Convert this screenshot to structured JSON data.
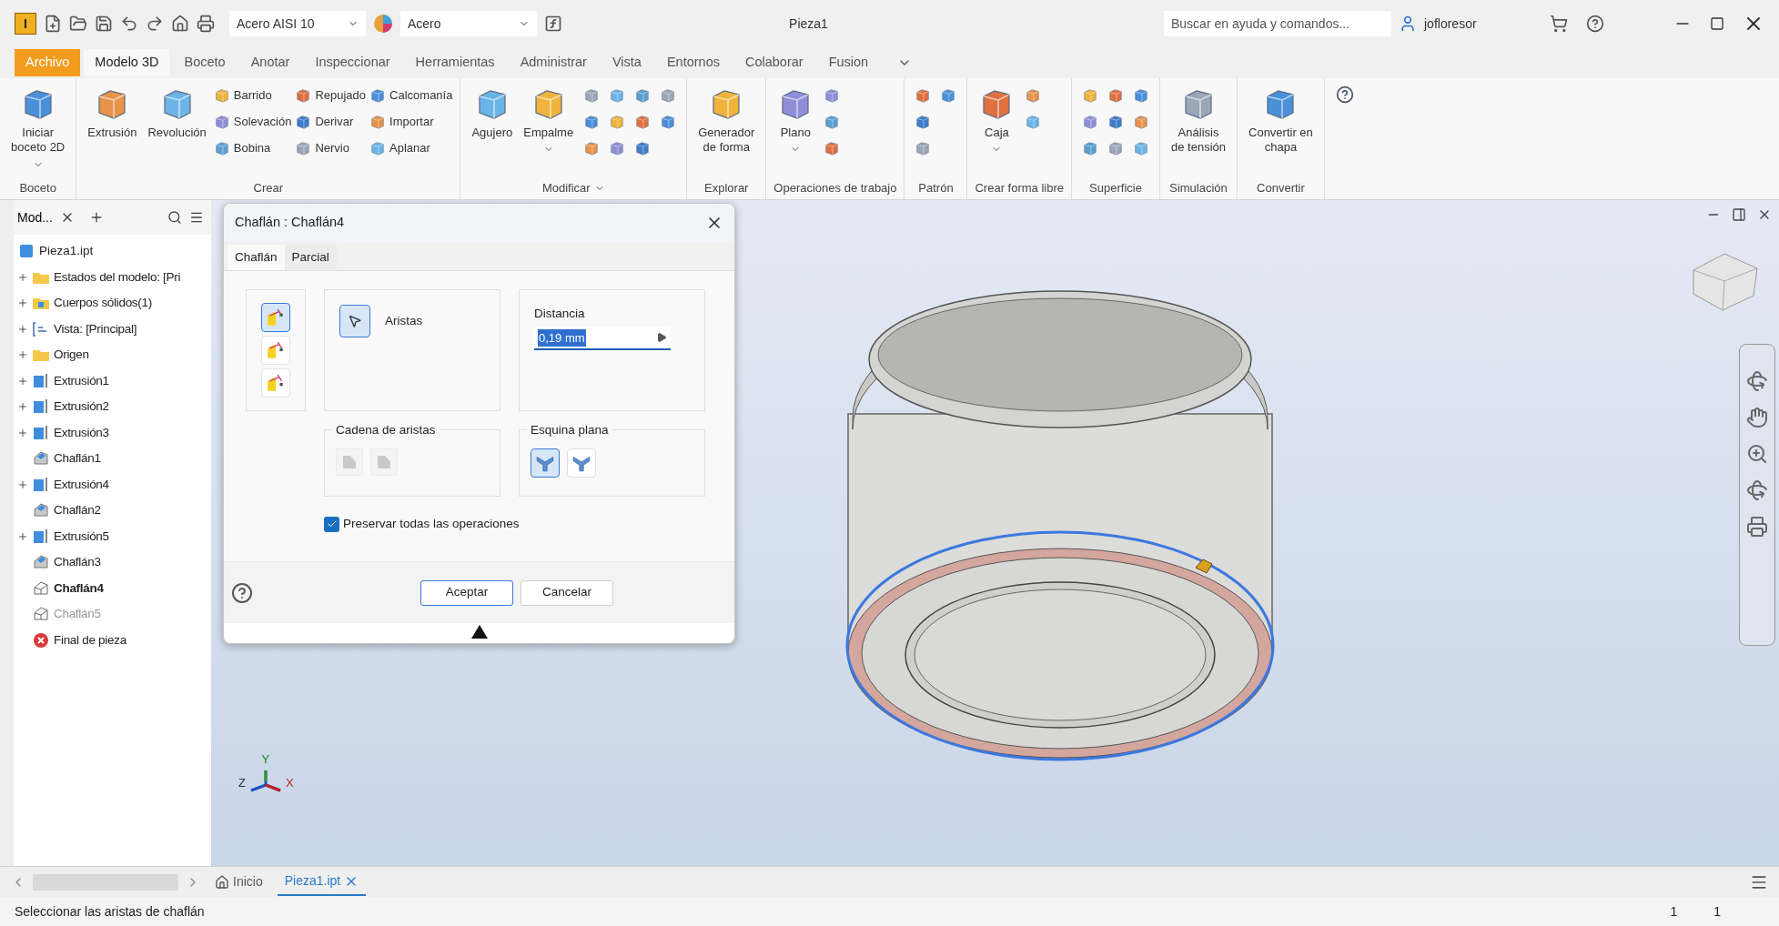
{
  "title_bar": {
    "logo": "I",
    "material": "Acero AISI 10",
    "appearance": "Acero",
    "document": "Pieza1",
    "search": {
      "placeholder": "Buscar en ayuda y comandos..."
    },
    "user": "jofloresor"
  },
  "menu_tabs": [
    {
      "label": "Archivo",
      "kind": "file",
      "selected": false
    },
    {
      "label": "Modelo 3D",
      "kind": "tab",
      "selected": true
    },
    {
      "label": "Boceto",
      "kind": "tab",
      "selected": false
    },
    {
      "label": "Anotar",
      "kind": "tab",
      "selected": false
    },
    {
      "label": "Inspeccionar",
      "kind": "tab",
      "selected": false
    },
    {
      "label": "Herramientas",
      "kind": "tab",
      "selected": false
    },
    {
      "label": "Administrar",
      "kind": "tab",
      "selected": false
    },
    {
      "label": "Vista",
      "kind": "tab",
      "selected": false
    },
    {
      "label": "Entornos",
      "kind": "tab",
      "selected": false
    },
    {
      "label": "Colaborar",
      "kind": "tab",
      "selected": false
    },
    {
      "label": "Fusion",
      "kind": "tab",
      "selected": false
    }
  ],
  "ribbon": [
    {
      "label": "Boceto",
      "dropdown": false,
      "tools": [
        {
          "kind": "large",
          "label": "Iniciar\nboceto 2D",
          "dropdown": true
        }
      ]
    },
    {
      "label": "Crear",
      "dropdown": false,
      "tools": [
        {
          "kind": "large",
          "label": "Extrusión",
          "dropdown": false
        },
        {
          "kind": "large",
          "label": "Revolución",
          "dropdown": false
        },
        {
          "kind": "small",
          "label": "Barrido"
        },
        {
          "kind": "small",
          "label": "Solevación"
        },
        {
          "kind": "small",
          "label": "Bobina"
        },
        {
          "kind": "small",
          "label": "Repujado"
        },
        {
          "kind": "small",
          "label": "Derivar"
        },
        {
          "kind": "small",
          "label": "Nervio"
        },
        {
          "kind": "small",
          "label": "Calcomanía"
        },
        {
          "kind": "small",
          "label": "Importar"
        },
        {
          "kind": "small",
          "label": "Aplanar"
        }
      ]
    },
    {
      "label": "Modificar",
      "dropdown": true,
      "tools": [
        {
          "kind": "large",
          "label": "Agujero",
          "dropdown": false
        },
        {
          "kind": "large",
          "label": "Empalme",
          "dropdown": true
        },
        {
          "kind": "icon"
        },
        {
          "kind": "icon"
        },
        {
          "kind": "icon"
        },
        {
          "kind": "icon"
        },
        {
          "kind": "icon"
        },
        {
          "kind": "icon"
        },
        {
          "kind": "icon"
        },
        {
          "kind": "icon"
        },
        {
          "kind": "icon"
        },
        {
          "kind": "icon"
        },
        {
          "kind": "icon"
        }
      ]
    },
    {
      "label": "Explorar",
      "dropdown": false,
      "tools": [
        {
          "kind": "large",
          "label": "Generador\nde forma",
          "dropdown": false
        }
      ]
    },
    {
      "label": "Operaciones de trabajo",
      "dropdown": false,
      "tools": [
        {
          "kind": "large",
          "label": "Plano",
          "dropdown": true
        },
        {
          "kind": "icon"
        },
        {
          "kind": "icon"
        },
        {
          "kind": "icon"
        }
      ]
    },
    {
      "label": "Patrón",
      "dropdown": false,
      "tools": [
        {
          "kind": "icon"
        },
        {
          "kind": "icon"
        },
        {
          "kind": "icon"
        },
        {
          "kind": "icon"
        }
      ]
    },
    {
      "label": "Crear forma libre",
      "dropdown": false,
      "tools": [
        {
          "kind": "large",
          "label": "Caja",
          "dropdown": true
        },
        {
          "kind": "icon"
        },
        {
          "kind": "icon"
        }
      ]
    },
    {
      "label": "Superficie",
      "dropdown": false,
      "tools": [
        {
          "kind": "icon"
        },
        {
          "kind": "icon"
        },
        {
          "kind": "icon"
        },
        {
          "kind": "icon"
        },
        {
          "kind": "icon"
        },
        {
          "kind": "icon"
        },
        {
          "kind": "icon"
        },
        {
          "kind": "icon"
        },
        {
          "kind": "icon"
        }
      ]
    },
    {
      "label": "Simulación",
      "dropdown": false,
      "tools": [
        {
          "kind": "large",
          "label": "Análisis\nde tensión",
          "dropdown": false
        }
      ]
    },
    {
      "label": "Convertir",
      "dropdown": false,
      "tools": [
        {
          "kind": "large",
          "label": "Convertir en\nchapa",
          "dropdown": false
        }
      ]
    }
  ],
  "browser": {
    "title": "Mod...",
    "tree": [
      {
        "label": "Pieza1.ipt",
        "kind": "part",
        "active": false,
        "disabled": false,
        "children": [
          {
            "label": "Estados del modelo: [Pri",
            "kind": "folder",
            "collapsed": true,
            "active": false,
            "disabled": false
          },
          {
            "label": "Cuerpos sólidos(1)",
            "kind": "bodies",
            "collapsed": true,
            "active": false,
            "disabled": false
          },
          {
            "label": "Vista: [Principal]",
            "kind": "view",
            "collapsed": true,
            "active": false,
            "disabled": false
          },
          {
            "label": "Origen",
            "kind": "folder",
            "collapsed": true,
            "active": false,
            "disabled": false
          },
          {
            "label": "Extrusión1",
            "kind": "extrusion",
            "collapsed": true,
            "active": false,
            "disabled": false
          },
          {
            "label": "Extrusión2",
            "kind": "extrusion",
            "collapsed": true,
            "active": false,
            "disabled": false
          },
          {
            "label": "Extrusión3",
            "kind": "extrusion",
            "collapsed": true,
            "active": false,
            "disabled": false
          },
          {
            "label": "Chaflán1",
            "kind": "chamfer",
            "collapsed": false,
            "active": false,
            "disabled": false
          },
          {
            "label": "Extrusión4",
            "kind": "extrusion",
            "collapsed": true,
            "active": false,
            "disabled": false
          },
          {
            "label": "Chaflán2",
            "kind": "chamfer",
            "collapsed": false,
            "active": false,
            "disabled": false
          },
          {
            "label": "Extrusión5",
            "kind": "extrusion",
            "collapsed": true,
            "active": false,
            "disabled": false
          },
          {
            "label": "Chaflán3",
            "kind": "chamfer",
            "collapsed": false,
            "active": false,
            "disabled": false
          },
          {
            "label": "Chaflán4",
            "kind": "chamfer-new",
            "collapsed": false,
            "active": true,
            "disabled": false
          },
          {
            "label": "Chaflán5",
            "kind": "chamfer-new",
            "collapsed": false,
            "active": false,
            "disabled": true
          },
          {
            "label": "Final de pieza",
            "kind": "end",
            "collapsed": false,
            "active": false,
            "disabled": false
          }
        ]
      }
    ]
  },
  "dialog": {
    "title": "Chaflán : Chaflán4",
    "tabs": [
      {
        "label": "Chaflán",
        "selected": true
      },
      {
        "label": "Parcial",
        "selected": false
      }
    ],
    "methods": [
      {
        "selected": true
      },
      {
        "selected": false
      },
      {
        "selected": false
      }
    ],
    "edges": {
      "label": "Aristas",
      "selected": true
    },
    "distance": {
      "label": "Distancia",
      "value": "0,19 mm"
    },
    "edge_chain": {
      "label": "Cadena de aristas",
      "options": [
        {
          "disabled": true
        },
        {
          "disabled": true
        }
      ]
    },
    "flat_corner": {
      "label": "Esquina plana",
      "options": [
        {
          "selected": true
        },
        {
          "selected": false
        }
      ]
    },
    "preserve": {
      "label": "Preservar todas las operaciones",
      "checked": true
    },
    "buttons": [
      {
        "label": "Aceptar",
        "default": true
      },
      {
        "label": "Cancelar",
        "default": false
      }
    ]
  },
  "viewport": {
    "axis_labels": [
      "Z",
      "Y",
      "X"
    ]
  },
  "doc_tabs": [
    {
      "label": "Inicio",
      "kind": "home",
      "selected": false
    },
    {
      "label": "Pieza1.ipt",
      "kind": "doc",
      "selected": true
    }
  ],
  "status_bar": {
    "message": "Seleccionar las aristas de chaflán",
    "counters": [
      "1",
      "1"
    ]
  }
}
